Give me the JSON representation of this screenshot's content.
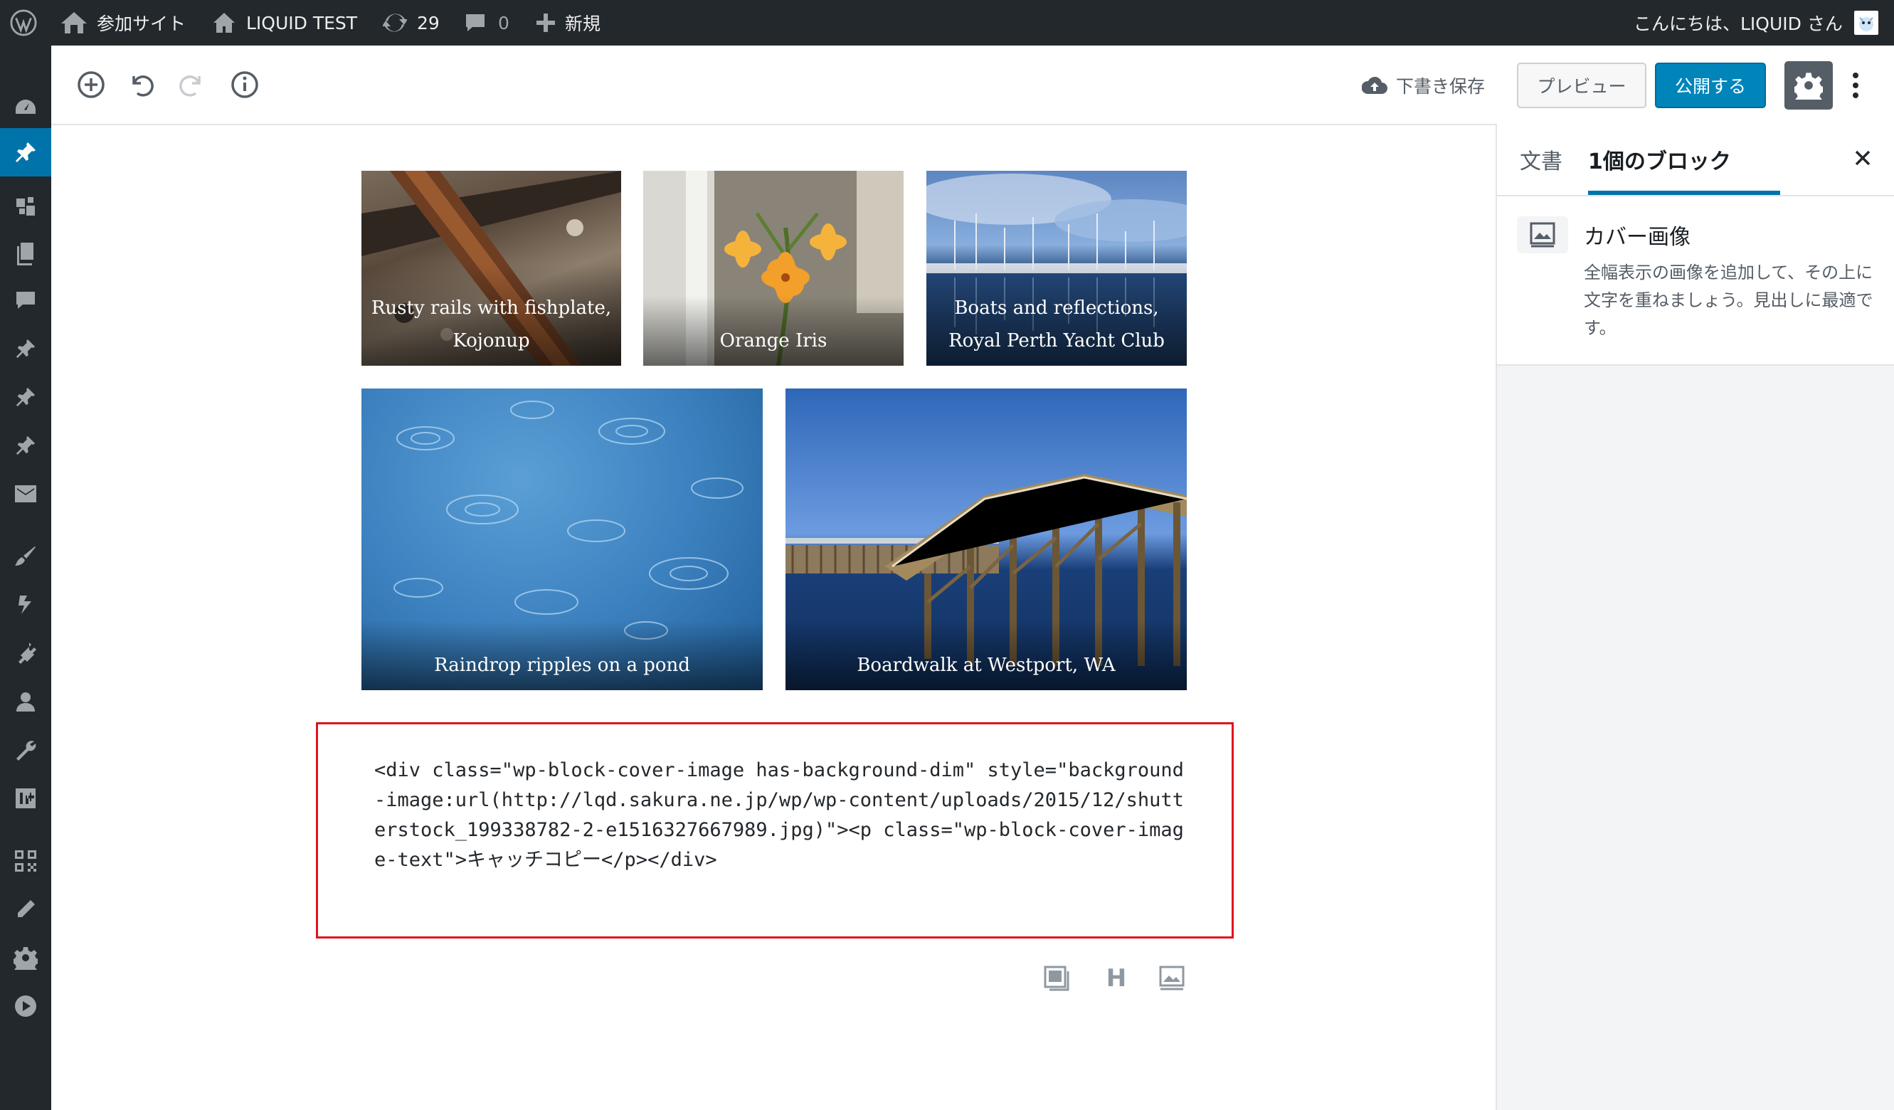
{
  "adminbar": {
    "site_name": "参加サイト",
    "site_title": "LIQUID TEST",
    "updates_count": "29",
    "comments_count": "0",
    "new_label": "新規",
    "greeting": "こんにちは、LIQUID さん"
  },
  "header": {
    "save_draft": "下書き保存",
    "preview": "プレビュー",
    "publish": "公開する"
  },
  "sidebar": {
    "tab_document": "文書",
    "tab_block": "1個のブロック",
    "block_title": "カバー画像",
    "block_description": "全幅表示の画像を追加して、その上に文字を重ねましょう。見出しに最適です。"
  },
  "gallery": [
    {
      "caption": "Rusty rails with fishplate, Kojonup"
    },
    {
      "caption": "Orange Iris"
    },
    {
      "caption": "Boats and reflections, Royal Perth Yacht Club"
    },
    {
      "caption": "Raindrop ripples on a pond"
    },
    {
      "caption": "Boardwalk at Westport, WA"
    }
  ],
  "code": {
    "text": "<div class=\"wp-block-cover-image has-background-dim\" style=\"background-image:url(http://lqd.sakura.ne.jp/wp/wp-content/uploads/2015/12/shutterstock_199338782-2-e1516327667989.jpg)\"><p class=\"wp-block-cover-image-text\">キャッチコピー</p></div>"
  },
  "inserter": {
    "heading_letter": "H"
  },
  "colors": {
    "admin_bar": "#23282d",
    "accent": "#0073aa",
    "publish_bg": "#0085ba",
    "highlight_border": "#e0141e"
  }
}
